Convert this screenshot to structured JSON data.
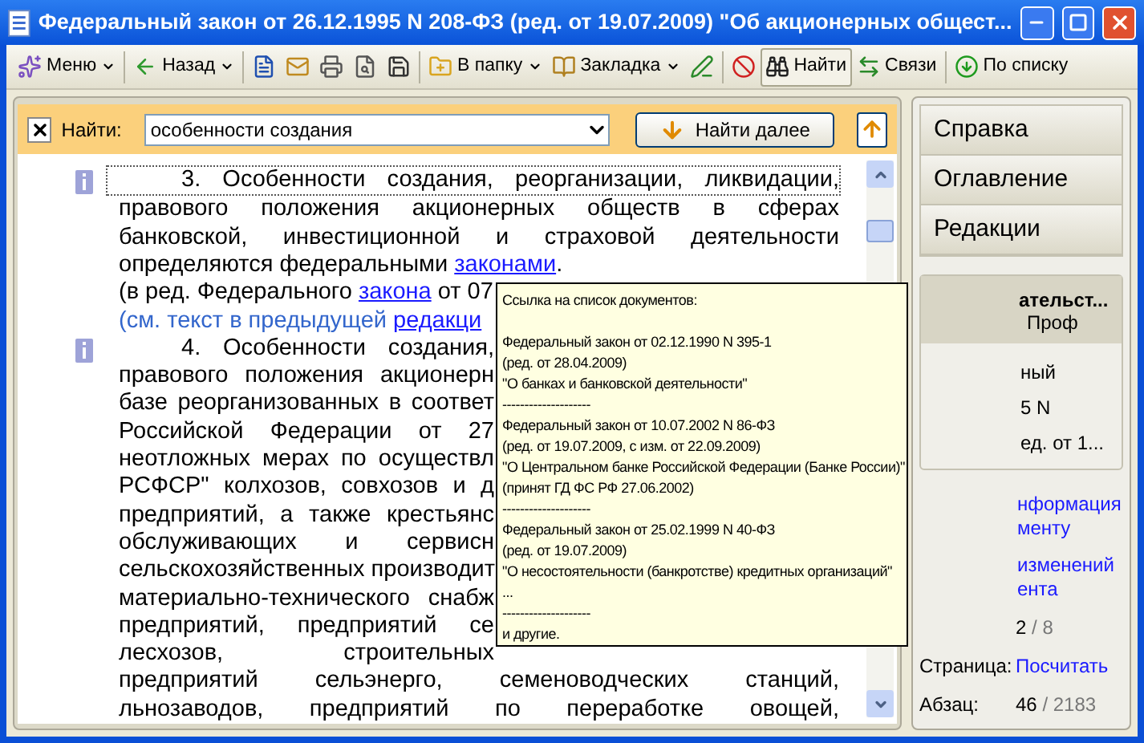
{
  "window": {
    "title": "Федеральный закон от 26.12.1995 N 208-ФЗ (ред. от 19.07.2009) \"Об акционерных общест..."
  },
  "toolbar": [
    [
      {
        "kind": "menu",
        "label": "Меню",
        "dropdown": true,
        "selected": false
      }
    ],
    [
      {
        "kind": "back",
        "label": "Назад",
        "dropdown": true,
        "selected": false
      }
    ],
    [
      {
        "kind": "word",
        "selected": false
      },
      {
        "kind": "mail",
        "selected": false
      },
      {
        "kind": "print",
        "selected": false
      },
      {
        "kind": "preview",
        "selected": false
      },
      {
        "kind": "save",
        "selected": false
      }
    ],
    [
      {
        "kind": "folder",
        "label": "В папку",
        "dropdown": true,
        "selected": false
      },
      {
        "kind": "bookmark",
        "label": "Закладка",
        "dropdown": true,
        "selected": false
      },
      {
        "kind": "edit",
        "selected": false
      }
    ],
    [
      {
        "kind": "clear",
        "selected": false
      },
      {
        "kind": "find",
        "label": "Найти",
        "selected": true
      },
      {
        "kind": "links",
        "label": "Связи",
        "selected": false
      }
    ],
    [
      {
        "kind": "list",
        "label": "По списку",
        "selected": false
      }
    ]
  ],
  "find_bar": {
    "label": "Найти:",
    "value": "особенности создания",
    "next_button": "Найти далее"
  },
  "document": {
    "paragraphs": [
      {
        "focused": true,
        "lines": [
          {
            "indent": true,
            "justify": true,
            "partial": false,
            "kind": "text",
            "parts": [
              {
                "text": "3. Особенности создания, реорганизации, ликвидации,",
                "link": false
              }
            ]
          },
          {
            "indent": false,
            "justify": true,
            "partial": false,
            "kind": "text",
            "parts": [
              {
                "text": "правового положения акционерных обществ в сферах",
                "link": false
              }
            ]
          },
          {
            "indent": false,
            "justify": true,
            "partial": false,
            "kind": "text",
            "parts": [
              {
                "text": "банковской, инвестиционной и страховой деятельности",
                "link": false
              }
            ]
          },
          {
            "indent": false,
            "justify": false,
            "partial": false,
            "kind": "text",
            "parts": [
              {
                "text": "определяются федеральными ",
                "link": false
              },
              {
                "text": "законами",
                "link": true
              },
              {
                "text": ".",
                "link": false
              }
            ]
          },
          {
            "indent": false,
            "justify": false,
            "partial": true,
            "kind": "text",
            "parts": [
              {
                "text": "(в ред. Федерального ",
                "link": false
              },
              {
                "text": "закона",
                "link": true
              },
              {
                "text": " от 07",
                "link": false
              }
            ]
          },
          {
            "indent": false,
            "justify": false,
            "partial": true,
            "kind": "note",
            "parts": [
              {
                "text": "(см. текст в предыдущей ",
                "link": false
              },
              {
                "text": "редакци",
                "link": true
              }
            ]
          }
        ]
      },
      {
        "focused": false,
        "lines": [
          {
            "indent": true,
            "justify": true,
            "partial": true,
            "kind": "text",
            "parts": [
              {
                "text": "4. Особенности создания,",
                "link": false
              }
            ]
          },
          {
            "indent": false,
            "justify": true,
            "partial": true,
            "kind": "text",
            "parts": [
              {
                "text": "правового положения акционерн",
                "link": false
              }
            ]
          },
          {
            "indent": false,
            "justify": true,
            "partial": true,
            "kind": "text",
            "parts": [
              {
                "text": "базе реорганизованных в соответ",
                "link": false
              }
            ]
          },
          {
            "indent": false,
            "justify": true,
            "partial": true,
            "kind": "text",
            "parts": [
              {
                "text": "Российской Федерации от 27",
                "link": false
              }
            ]
          },
          {
            "indent": false,
            "justify": true,
            "partial": true,
            "kind": "text",
            "parts": [
              {
                "text": "неотложных мерах по осуществл",
                "link": false
              }
            ]
          },
          {
            "indent": false,
            "justify": true,
            "partial": true,
            "kind": "text",
            "parts": [
              {
                "text": "РСФСР\" колхозов, совхозов и д",
                "link": false
              }
            ]
          },
          {
            "indent": false,
            "justify": true,
            "partial": true,
            "kind": "text",
            "parts": [
              {
                "text": "предприятий, а также крестьянс",
                "link": false
              }
            ]
          },
          {
            "indent": false,
            "justify": true,
            "partial": true,
            "kind": "text",
            "parts": [
              {
                "text": "обслуживающих и сервисн",
                "link": false
              }
            ]
          },
          {
            "indent": false,
            "justify": true,
            "partial": true,
            "kind": "text",
            "parts": [
              {
                "text": "сельскохозяйственных производит",
                "link": false
              }
            ]
          },
          {
            "indent": false,
            "justify": true,
            "partial": true,
            "kind": "text",
            "parts": [
              {
                "text": "материально-технического снабж",
                "link": false
              }
            ]
          },
          {
            "indent": false,
            "justify": true,
            "partial": true,
            "kind": "text",
            "parts": [
              {
                "text": "предприятий, предприятий се",
                "link": false
              }
            ]
          },
          {
            "indent": false,
            "justify": true,
            "partial": true,
            "kind": "text",
            "parts": [
              {
                "text": "лесхозов, строительных",
                "link": false
              }
            ]
          },
          {
            "indent": false,
            "justify": true,
            "partial": false,
            "kind": "text",
            "parts": [
              {
                "text": "предприятий сельэнерго, семеноводческих станций,",
                "link": false
              }
            ]
          },
          {
            "indent": false,
            "justify": true,
            "partial": false,
            "kind": "text",
            "parts": [
              {
                "text": "льнозаводов, предприятий по переработке овощей,",
                "link": false
              }
            ]
          }
        ]
      }
    ]
  },
  "tooltip": {
    "title": "Ссылка на список документов:",
    "lines": [
      "Федеральный закон от 02.12.1990 N 395-1",
      "(ред. от 28.04.2009)",
      "\"О банках и банковской деятельности\"",
      "--------------------",
      "Федеральный закон от 10.07.2002 N 86-ФЗ",
      "(ред. от 19.07.2009, с изм. от 22.09.2009)",
      "\"О Центральном банке Российской Федерации (Банке России)\"",
      "(принят ГД ФС РФ 27.06.2002)",
      "--------------------",
      "Федеральный закон от 25.02.1999 N 40-ФЗ",
      "(ред. от 19.07.2009)",
      "\"О несостоятельности (банкротстве) кредитных организаций\"",
      "...",
      "--------------------",
      "и другие."
    ]
  },
  "right_panel": {
    "tabs": [
      "Справка",
      "Оглавление",
      "Редакции"
    ],
    "card": {
      "header": [
        "ательст...",
        "Проф"
      ],
      "body": [
        "ный",
        "5 N",
        "ед. от 1..."
      ]
    },
    "links": [
      [
        "нформация",
        "менту"
      ],
      [
        "изменений",
        "ента"
      ]
    ],
    "stats": [
      {
        "value": "2",
        "total": "/ 8",
        "kind": "count"
      },
      {
        "label": "Страница:",
        "value": "Посчитать",
        "kind": "link"
      },
      {
        "label": "Абзац:",
        "value": "46",
        "total": "/ 2183",
        "kind": "count"
      }
    ]
  }
}
